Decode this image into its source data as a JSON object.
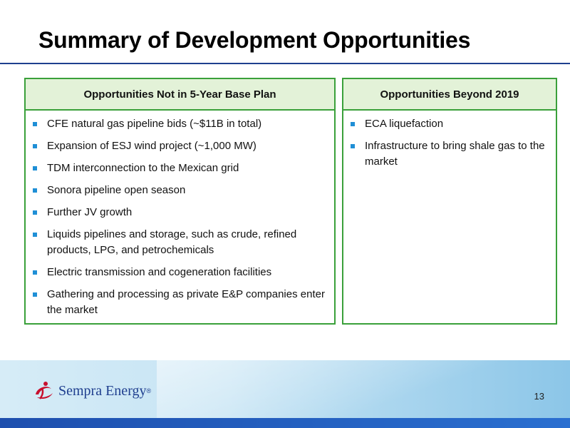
{
  "slide": {
    "title": "Summary of Development Opportunities",
    "page_number": "13"
  },
  "left_panel": {
    "header": "Opportunities Not in 5-Year Base Plan",
    "items": [
      "CFE natural gas pipeline bids (~$11B in total)",
      "Expansion of ESJ wind project  (~1,000 MW)",
      "TDM interconnection to the Mexican grid",
      "Sonora pipeline open season",
      "Further JV growth",
      "Liquids pipelines and storage, such as crude, refined products, LPG, and petrochemicals",
      "Electric transmission and cogeneration facilities",
      "Gathering and processing as private E&P companies enter the market"
    ]
  },
  "right_panel": {
    "header": "Opportunities Beyond 2019",
    "items": [
      "ECA liquefaction",
      "Infrastructure to bring shale gas to the market"
    ]
  },
  "logo": {
    "text": "Sempra Energy",
    "trademark": "®"
  },
  "colors": {
    "panel_border": "#3aa03a",
    "panel_header_bg": "#e3f2d8",
    "bullet": "#1f8fd6",
    "title_rule": "#1f3f8f",
    "footer_bar": "#1e4fae"
  }
}
